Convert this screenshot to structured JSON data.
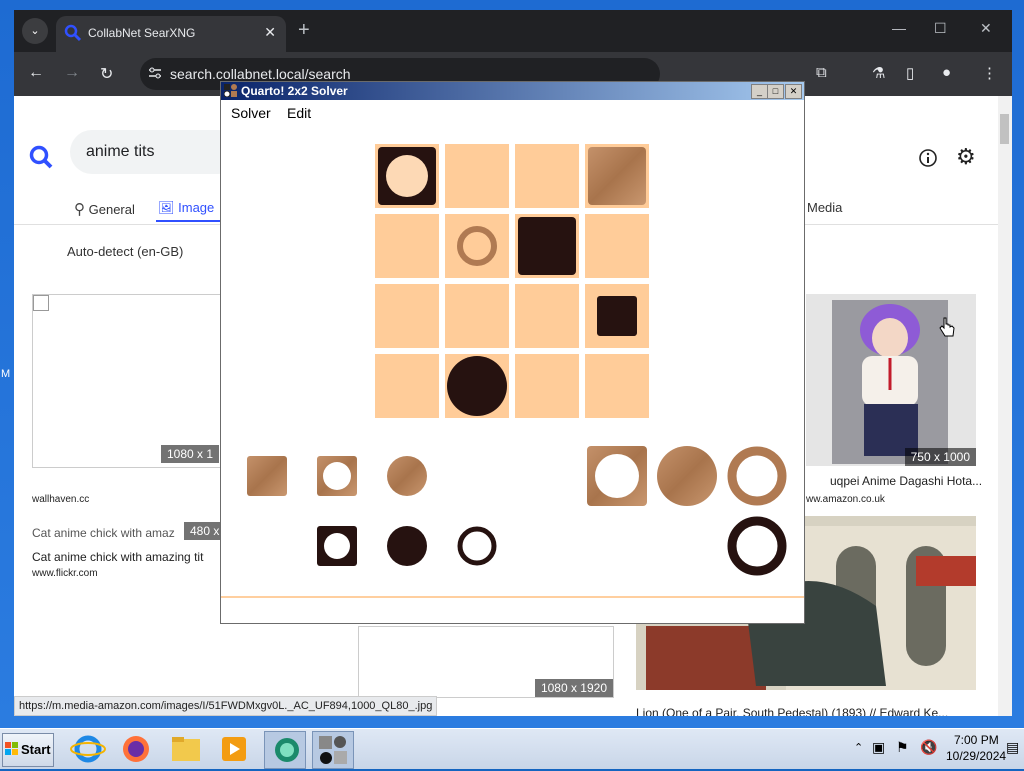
{
  "desktop": {
    "edge_label": "M"
  },
  "browser": {
    "tab_title": "CollabNet SearXNG",
    "url": "search.collabnet.local/search",
    "search_query": "anime tits",
    "categories": [
      "General",
      "Image",
      "Media"
    ],
    "active_category": "Image",
    "language": "Auto-detect (en-GB)",
    "results": [
      {
        "size": "1080 x 1",
        "source": "wallhaven.cc"
      },
      {
        "size": "480 x",
        "caption": "Cat anime chick with amazing tit",
        "alt": "Cat anime chick with amaz",
        "source": "www.flickr.com"
      },
      {
        "size": "1080 x 1920"
      },
      {
        "size": "750 x 1000",
        "caption": "uqpei Anime Dagashi Hota...",
        "source": "ww.amazon.co.uk"
      },
      {
        "caption": "Lion (One of a Pair, South Pedestal) (1893) // Edward Ke..."
      }
    ],
    "status_url": "https://m.media-amazon.com/images/I/51FWDMxgv0L._AC_UF894,1000_QL80_.jpg"
  },
  "dialog": {
    "title": "Quarto! 2x2 Solver",
    "menus": [
      "Solver",
      "Edit"
    ]
  },
  "taskbar": {
    "start_label": "Start",
    "time": "7:00 PM",
    "date": "10/29/2024"
  },
  "colors": {
    "board_cell": "#ffcc99",
    "piece_dark": "#261210",
    "piece_light": "#b07a52",
    "piece_hollow": "#fdd9b5"
  }
}
